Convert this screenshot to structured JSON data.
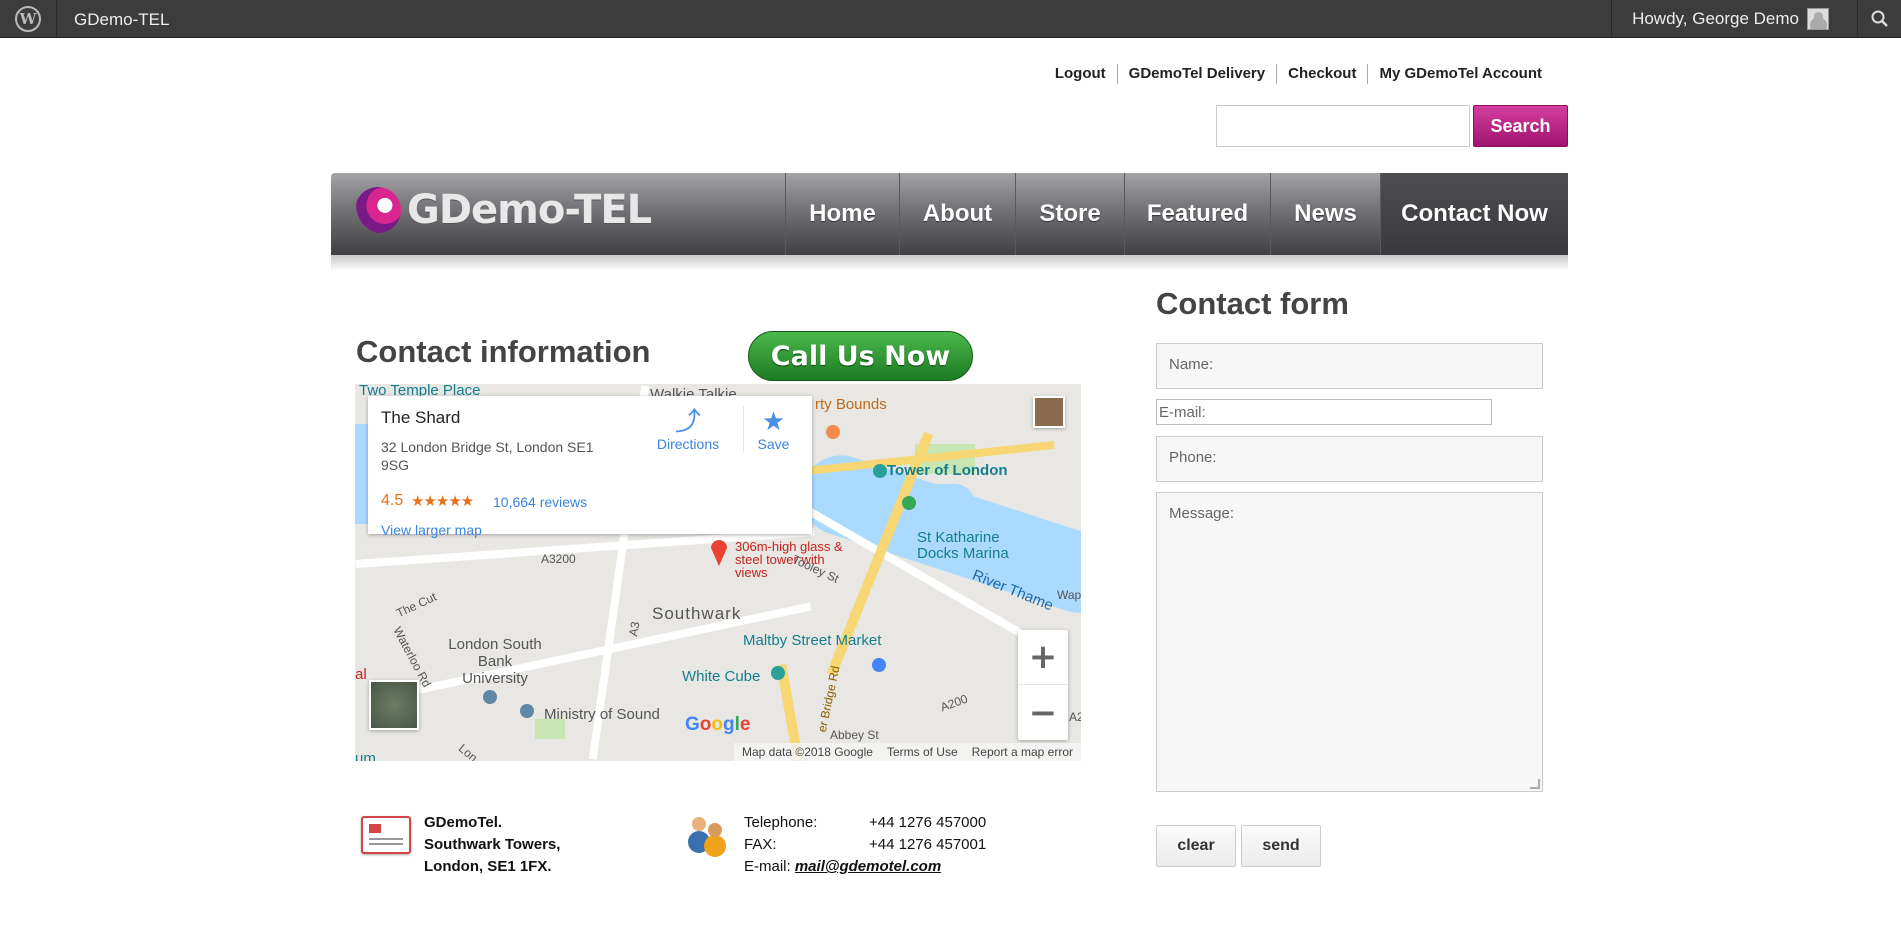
{
  "adminbar": {
    "site_name": "GDemo-TEL",
    "howdy": "Howdy, George Demo"
  },
  "toplinks": [
    "Logout",
    "GDemoTel Delivery",
    "Checkout",
    "My GDemoTel Account"
  ],
  "search": {
    "button_label": "Search",
    "placeholder": ""
  },
  "logo": {
    "text": "GDemo-TEL"
  },
  "nav": {
    "items": [
      {
        "label": "Home"
      },
      {
        "label": "About"
      },
      {
        "label": "Store"
      },
      {
        "label": "Featured"
      },
      {
        "label": "News"
      },
      {
        "label": "Contact Now"
      }
    ],
    "active": "Contact Now"
  },
  "contact_info": {
    "heading": "Contact information",
    "call_button": "Call Us Now"
  },
  "map": {
    "card": {
      "place": "The Shard",
      "address": "32 London Bridge St, London SE1 9SG",
      "rating": "4.5",
      "stars": "★★★★★",
      "reviews": "10,664 reviews",
      "larger_map": "View larger map",
      "directions": "Directions",
      "save": "Save"
    },
    "labels": {
      "two_temple": "Two Temple Place",
      "walkie": "Walkie Talkie",
      "party_bounds": "rty Bounds",
      "tower": "Tower of London",
      "katharine": "St Katharine Docks Marina",
      "shard_desc": "306m-high glass & steel tower with views",
      "a3200": "A3200",
      "the_cut": "The Cut",
      "tooley": "Tooley St",
      "southwark": "Southwark",
      "thames": "River Thame",
      "wap": "Wap",
      "maltby": "Maltby Street Market",
      "southbank": "London South Bank University",
      "waterloo": "Waterloo Rd",
      "a3": "A3",
      "whitecube": "White Cube",
      "bridge_rd": "er Bridge Rd",
      "ministry": "Ministry of Sound",
      "abbey": "Abbey St",
      "a200": "A200",
      "al": "al",
      "um": "um",
      "a2": "A2",
      "lon": "Lon"
    },
    "attribution": [
      "Map data ©2018 Google",
      "Terms of Use",
      "Report a map error"
    ]
  },
  "address": {
    "line1": "GDemoTel.",
    "line2": "Southwark Towers,",
    "line3": "London, SE1 1FX."
  },
  "phones": {
    "tel_label": "Telephone:",
    "tel": "+44 1276 457000",
    "fax_label": "FAX:",
    "fax": "+44 1276 457001",
    "email_label": "E-mail:",
    "email": "mail@gdemotel.com"
  },
  "form": {
    "heading": "Contact form",
    "name_placeholder": "Name:",
    "email_placeholder": "E-mail:",
    "phone_placeholder": "Phone:",
    "message_placeholder": "Message:",
    "clear": "clear",
    "send": "send"
  },
  "colors": {
    "accent": "#b5177f",
    "call_green": "#2e8b36",
    "admin_bar": "#3c3c3c"
  }
}
